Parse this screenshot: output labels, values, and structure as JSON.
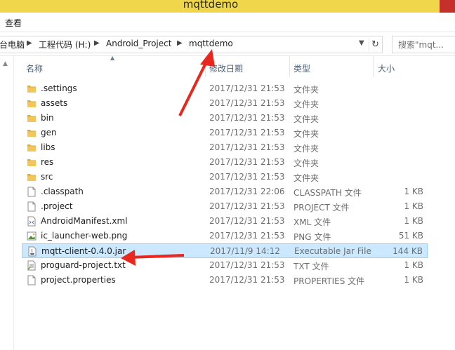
{
  "window": {
    "title": "mqttdemo"
  },
  "ribbon": {
    "view_tab": "查看"
  },
  "address": {
    "crumbs": [
      "台电脑",
      "工程代码 (H:)",
      "Android_Project",
      "mqttdemo"
    ],
    "search_placeholder": "搜索\"mqt..."
  },
  "columns": {
    "name": "名称",
    "date": "修改日期",
    "type": "类型",
    "size": "大小"
  },
  "files": [
    {
      "name": ".settings",
      "date": "2017/12/31 21:53",
      "type": "文件夹",
      "size": "",
      "icon": "folder-icon"
    },
    {
      "name": "assets",
      "date": "2017/12/31 21:53",
      "type": "文件夹",
      "size": "",
      "icon": "folder-icon"
    },
    {
      "name": "bin",
      "date": "2017/12/31 21:53",
      "type": "文件夹",
      "size": "",
      "icon": "folder-icon"
    },
    {
      "name": "gen",
      "date": "2017/12/31 21:53",
      "type": "文件夹",
      "size": "",
      "icon": "folder-icon"
    },
    {
      "name": "libs",
      "date": "2017/12/31 21:53",
      "type": "文件夹",
      "size": "",
      "icon": "folder-icon"
    },
    {
      "name": "res",
      "date": "2017/12/31 21:53",
      "type": "文件夹",
      "size": "",
      "icon": "folder-icon"
    },
    {
      "name": "src",
      "date": "2017/12/31 21:53",
      "type": "文件夹",
      "size": "",
      "icon": "folder-icon"
    },
    {
      "name": ".classpath",
      "date": "2017/12/31 22:06",
      "type": "CLASSPATH 文件",
      "size": "1 KB",
      "icon": "file-icon"
    },
    {
      "name": ".project",
      "date": "2017/12/31 21:53",
      "type": "PROJECT 文件",
      "size": "1 KB",
      "icon": "file-icon"
    },
    {
      "name": "AndroidManifest.xml",
      "date": "2017/12/31 21:53",
      "type": "XML 文件",
      "size": "1 KB",
      "icon": "xml-file-icon"
    },
    {
      "name": "ic_launcher-web.png",
      "date": "2017/12/31 21:53",
      "type": "PNG 文件",
      "size": "51 KB",
      "icon": "image-file-icon"
    },
    {
      "name": "mqtt-client-0.4.0.jar",
      "date": "2017/11/9 14:12",
      "type": "Executable Jar File",
      "size": "144 KB",
      "icon": "jar-file-icon",
      "selected": true
    },
    {
      "name": "proguard-project.txt",
      "date": "2017/12/31 21:53",
      "type": "TXT 文件",
      "size": "1 KB",
      "icon": "text-file-icon"
    },
    {
      "name": "project.properties",
      "date": "2017/12/31 21:53",
      "type": "PROPERTIES 文件",
      "size": "1 KB",
      "icon": "file-icon"
    }
  ],
  "colors": {
    "titlebar": "#f0d64a",
    "close_button": "#c5302a",
    "selection_fill": "#cce8ff",
    "selection_border": "#99d1ff",
    "annotation_arrow": "#e8281e",
    "folder": "#e8b94b"
  }
}
